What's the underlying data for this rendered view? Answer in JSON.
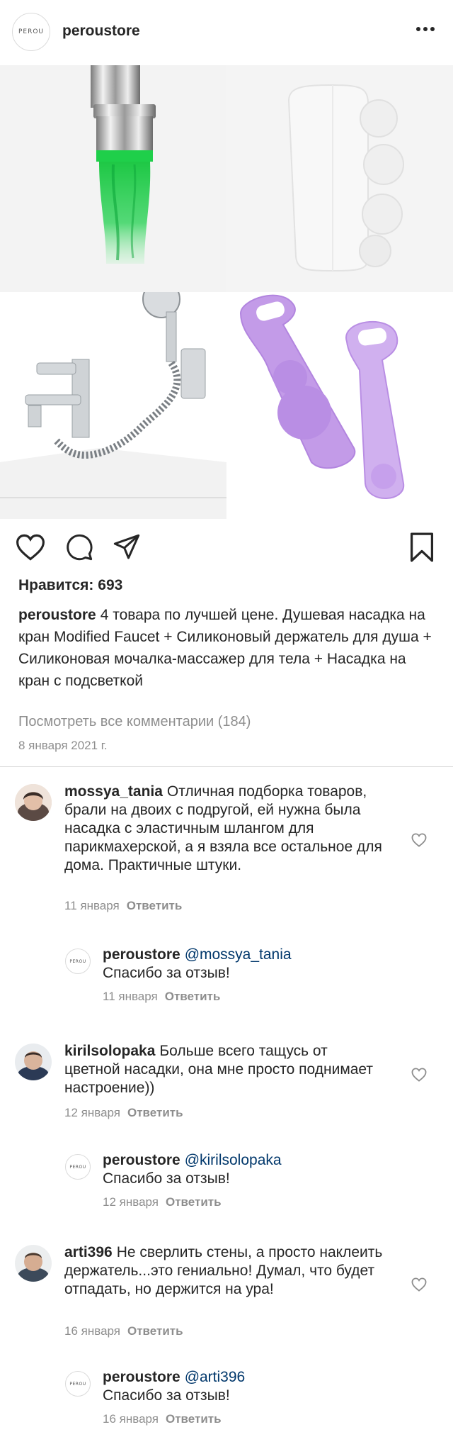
{
  "header": {
    "username": "peroustore",
    "logo_text": "PEROU"
  },
  "post": {
    "likes_label": "Нравится: 693",
    "caption_username": "peroustore",
    "caption_text": "4 товара по лучшей цене. Душевая насадка на кран Modified Faucet + Силиконовый держатель для душа + Силиконовая мочалка-массажер для тела + Насадка на кран с подсветкой",
    "view_all_comments": "Посмотреть все комментарии (184)",
    "date": "8 января 2021 г."
  },
  "icons": {
    "like": "heart-icon",
    "comment": "comment-icon",
    "share": "share-icon",
    "save": "bookmark-icon",
    "more": "more-dots-icon"
  },
  "comments": [
    {
      "username": "mossya_tania",
      "text": "Отличная подборка товаров, брали на двоих с подругой, ей нужна была насадка с эластичным шлангом для парикмахерской, а я взяла все остальное для дома. Практичные штуки.",
      "date": "11 января",
      "reply_label": "Ответить",
      "reply": {
        "username": "peroustore",
        "mention": "@mossya_tania",
        "text": "Спасибо за отзыв!",
        "date": "11 января",
        "reply_label": "Ответить",
        "logo_text": "PEROU"
      }
    },
    {
      "username": "kirilsolopaka",
      "text": "Больше всего тащусь от цветной насадки, она мне просто поднимает настроение))",
      "date": "12 января",
      "reply_label": "Ответить",
      "reply": {
        "username": "peroustore",
        "mention": "@kirilsolopaka",
        "text": "Спасибо за отзыв!",
        "date": "12 января",
        "reply_label": "Ответить",
        "logo_text": "PEROU"
      }
    },
    {
      "username": "arti396",
      "text": "Не сверлить стены, а просто наклеить держатель...это гениально! Думал, что будет отпадать, но держится на ура!",
      "date": "16 января",
      "reply_label": "Ответить",
      "reply": {
        "username": "peroustore",
        "mention": "@arti396",
        "text": "Спасибо за отзыв!",
        "date": "16 января",
        "reply_label": "Ответить",
        "logo_text": "PEROU"
      }
    }
  ],
  "colors": {
    "text": "#262626",
    "muted": "#8e8e8e",
    "mention": "#00376b",
    "divider": "#dbdbdb",
    "led_green": "#22c24a",
    "silicone_purple": "#c29ae6"
  }
}
